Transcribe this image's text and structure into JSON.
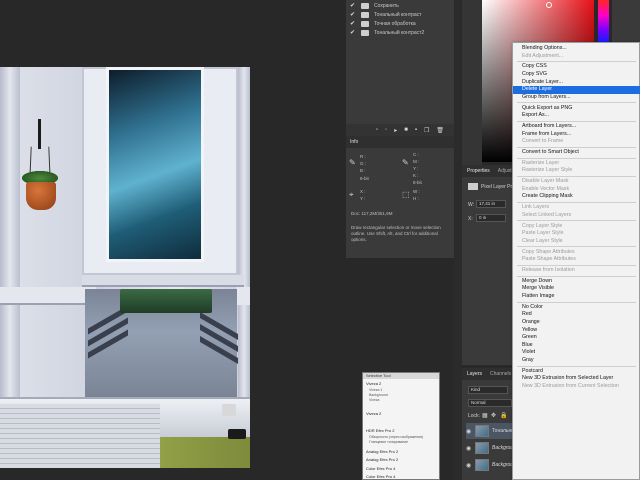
{
  "history": {
    "items": [
      {
        "label": "Сохранить",
        "checked": true
      },
      {
        "label": "Тональный контраст",
        "checked": true
      },
      {
        "label": "Точная обработка",
        "checked": true
      },
      {
        "label": "Тональный контраст2",
        "checked": true
      }
    ],
    "toolbar_icons": [
      "new-snapshot-icon",
      "camera-icon",
      "play-icon",
      "stop-icon",
      "add-icon",
      "duplicate-icon",
      "trash-icon"
    ]
  },
  "info": {
    "tab": "Info",
    "rgb1": {
      "r": "R :",
      "g": "G :",
      "b": "B :"
    },
    "cmyk": {
      "c": "C :",
      "m": "M :",
      "y": "Y :",
      "k": "K :"
    },
    "bits1": "8-bit",
    "bits2": "8-bit",
    "xy": {
      "x": "X :",
      "y": "Y :"
    },
    "wh": {
      "w": "W :",
      "h": "H :"
    },
    "doc": "Doc: 117,2M/351,9M",
    "help": "Draw rectangular selection or move selection outline. Use Shift, Alt, and Ctrl for additional options."
  },
  "properties": {
    "tabs": [
      "Properties",
      "Adjustments"
    ],
    "type": "Pixel Layer Properties",
    "w_label": "W:",
    "w_value": "17,41 in",
    "x_label": "X:",
    "x_value": "0 in"
  },
  "layers": {
    "tabs": [
      "Layers",
      "Channels"
    ],
    "kind": "Kind",
    "blend": "Normal",
    "lock": "Lock:",
    "rows": [
      {
        "name": "Тональный контраст2",
        "selected": true
      },
      {
        "name": "Background copy",
        "selected": false
      },
      {
        "name": "Background",
        "selected": false
      }
    ]
  },
  "context_menu": {
    "items": [
      {
        "label": "Blending Options...",
        "disabled": false
      },
      {
        "label": "Edit Adjustment...",
        "disabled": true
      },
      {
        "sep": true
      },
      {
        "label": "Copy CSS",
        "disabled": false
      },
      {
        "label": "Copy SVG",
        "disabled": false
      },
      {
        "label": "Duplicate Layer...",
        "disabled": false
      },
      {
        "label": "Delete Layer",
        "disabled": false,
        "highlighted": true
      },
      {
        "label": "Group from Layers...",
        "disabled": false
      },
      {
        "sep": true
      },
      {
        "label": "Quick Export as PNG",
        "disabled": false
      },
      {
        "label": "Export As...",
        "disabled": false
      },
      {
        "sep": true
      },
      {
        "label": "Artboard from Layers...",
        "disabled": false
      },
      {
        "label": "Frame from Layers...",
        "disabled": false
      },
      {
        "label": "Convert to Frame",
        "disabled": true
      },
      {
        "sep": true
      },
      {
        "label": "Convert to Smart Object",
        "disabled": false
      },
      {
        "sep": true
      },
      {
        "label": "Rasterize Layer",
        "disabled": true
      },
      {
        "label": "Rasterize Layer Style",
        "disabled": true
      },
      {
        "sep": true
      },
      {
        "label": "Disable Layer Mask",
        "disabled": true
      },
      {
        "label": "Enable Vector Mask",
        "disabled": true
      },
      {
        "label": "Create Clipping Mask",
        "disabled": false
      },
      {
        "sep": true
      },
      {
        "label": "Link Layers",
        "disabled": true
      },
      {
        "label": "Select Linked Layers",
        "disabled": true
      },
      {
        "sep": true
      },
      {
        "label": "Copy Layer Style",
        "disabled": true
      },
      {
        "label": "Paste Layer Style",
        "disabled": true
      },
      {
        "label": "Clear Layer Style",
        "disabled": true
      },
      {
        "sep": true
      },
      {
        "label": "Copy Shape Attributes",
        "disabled": true
      },
      {
        "label": "Paste Shape Attributes",
        "disabled": true
      },
      {
        "sep": true
      },
      {
        "label": "Release from Isolation",
        "disabled": true
      },
      {
        "sep": true
      },
      {
        "label": "Merge Down",
        "disabled": false
      },
      {
        "label": "Merge Visible",
        "disabled": false
      },
      {
        "label": "Flatten Image",
        "disabled": false
      },
      {
        "sep": true
      },
      {
        "label": "No Color",
        "disabled": false
      },
      {
        "label": "Red",
        "disabled": false
      },
      {
        "label": "Orange",
        "disabled": false
      },
      {
        "label": "Yellow",
        "disabled": false
      },
      {
        "label": "Green",
        "disabled": false
      },
      {
        "label": "Blue",
        "disabled": false
      },
      {
        "label": "Violet",
        "disabled": false
      },
      {
        "label": "Gray",
        "disabled": false
      },
      {
        "sep": true
      },
      {
        "label": "Postcard",
        "disabled": false
      },
      {
        "label": "New 3D Extrusion from Selected Layer",
        "disabled": false
      },
      {
        "label": "New 3D Extrusion from Current Selection",
        "disabled": true
      }
    ]
  },
  "filter_panel": {
    "header": "Selective Tool",
    "sections": [
      {
        "title": "Viveza 2",
        "lines": [
          "Viveza 1",
          "Background",
          "Viveza"
        ]
      },
      {
        "title": "Viveza 2",
        "lines": []
      },
      {
        "title": "HDR Efex Pro 2",
        "lines": [
          "Обзорность (через изображения)",
          "Глянцевое тонирование"
        ]
      },
      {
        "title": "Analog Efex Pro 2",
        "lines": []
      },
      {
        "title": "Analog Efex Pro 2",
        "lines": []
      },
      {
        "title": "Color Efex Pro 4",
        "lines": []
      },
      {
        "title": "Color Efex Pro 4",
        "lines": []
      }
    ]
  },
  "colors": {
    "menu_highlight": "#1c6ee0",
    "panel_bg": "#3a3a3a",
    "app_bg": "#282828"
  }
}
